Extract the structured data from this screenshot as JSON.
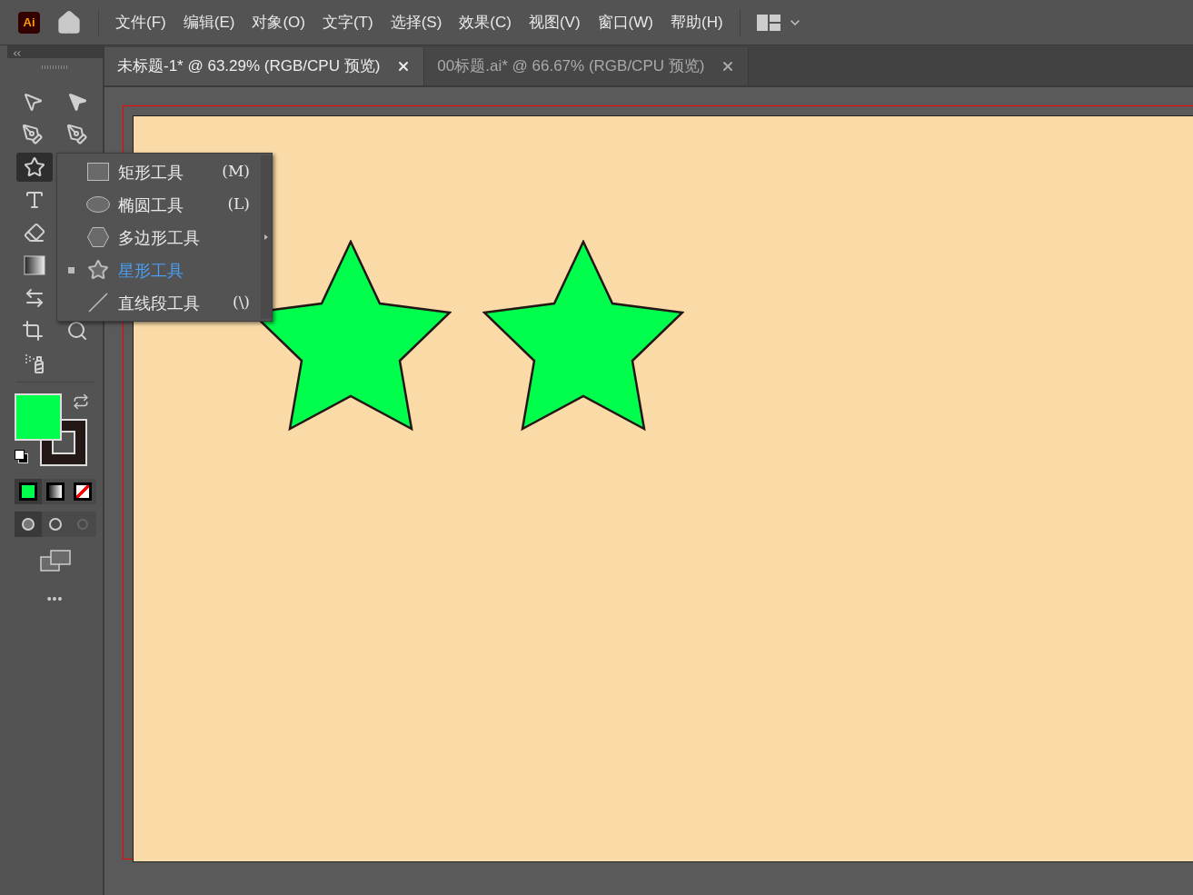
{
  "app": {
    "logo": "Ai"
  },
  "menu": [
    "文件(F)",
    "编辑(E)",
    "对象(O)",
    "文字(T)",
    "选择(S)",
    "效果(C)",
    "视图(V)",
    "窗口(W)",
    "帮助(H)"
  ],
  "tabs": [
    {
      "label": "未标题-1* @ 63.29% (RGB/CPU 预览)",
      "selected": true
    },
    {
      "label": "00标题.ai* @ 66.67% (RGB/CPU 预览)",
      "selected": false
    }
  ],
  "tools": [
    {
      "kind": "select",
      "selected": false
    },
    {
      "kind": "direct",
      "selected": false
    },
    {
      "kind": "pen",
      "selected": false
    },
    {
      "kind": "curvature",
      "selected": false
    },
    {
      "kind": "star",
      "selected": true
    },
    {
      "kind": "type",
      "selected": false
    },
    {
      "kind": "eraser",
      "selected": false
    },
    {
      "kind": "gradient",
      "selected": false
    },
    {
      "kind": "warp",
      "selected": false
    },
    {
      "kind": "artboard",
      "selected": false
    },
    {
      "kind": "zoom",
      "selected": false
    },
    {
      "kind": "sprayer",
      "selected": false
    }
  ],
  "flyout": [
    {
      "kind": "rect",
      "label": "矩形工具",
      "shortcut": "(M)",
      "selected": false,
      "submenu": false
    },
    {
      "kind": "ellipse",
      "label": "椭圆工具",
      "shortcut": "(L)",
      "selected": false,
      "submenu": false
    },
    {
      "kind": "polygon",
      "label": "多边形工具",
      "selected": false,
      "submenu": true
    },
    {
      "kind": "star",
      "label": "星形工具",
      "selected": true,
      "submenu": false
    },
    {
      "kind": "line",
      "label": "直线段工具",
      "shortcut": "(\\)",
      "selected": false,
      "submenu": false
    }
  ],
  "more": "•••"
}
